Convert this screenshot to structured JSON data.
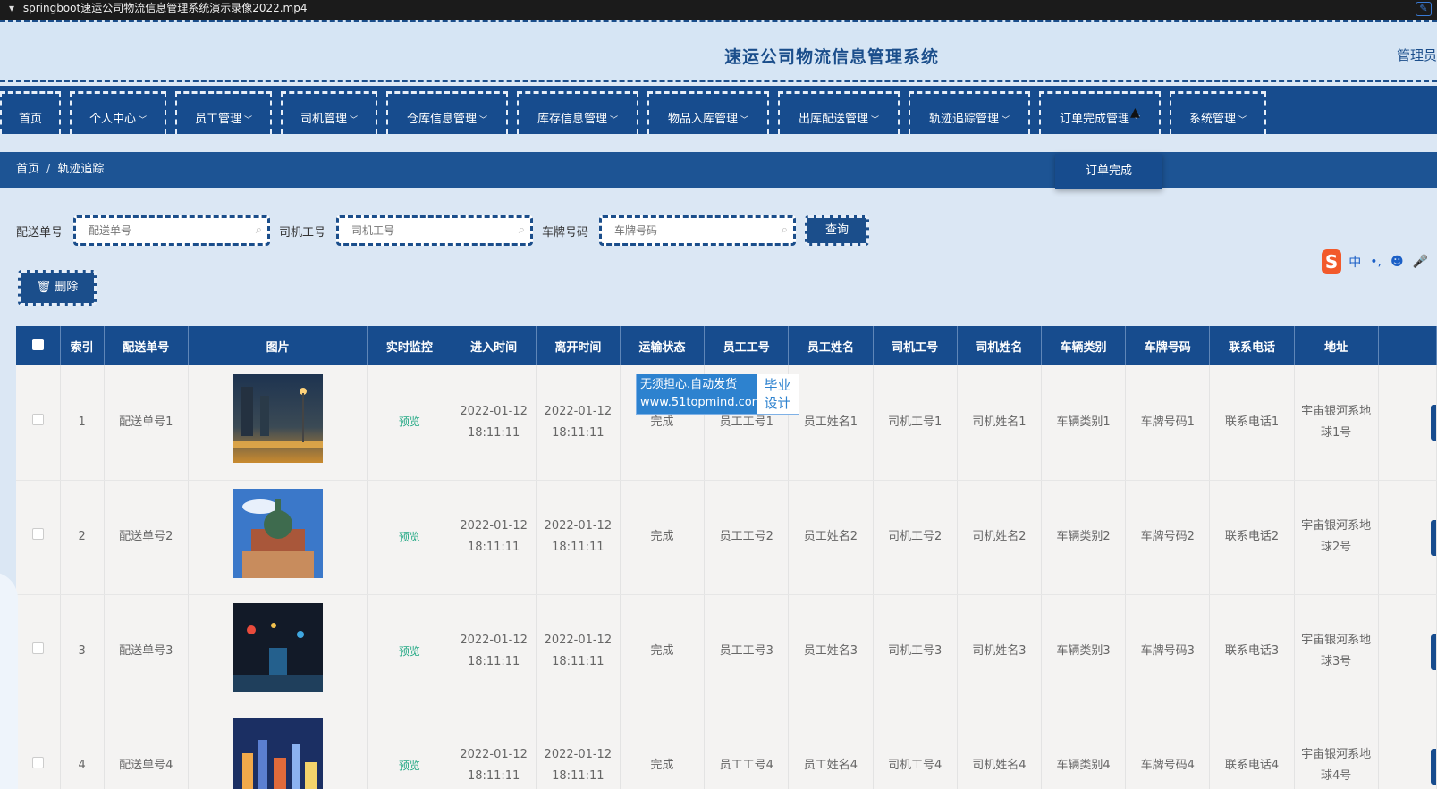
{
  "video_bar": {
    "title": "springboot速运公司物流信息管理系统演示录像2022.mp4"
  },
  "header": {
    "title": "速运公司物流信息管理系统",
    "user": "管理员"
  },
  "nav": {
    "items": [
      {
        "label": "首页",
        "has_dropdown": false
      },
      {
        "label": "个人中心",
        "has_dropdown": true
      },
      {
        "label": "员工管理",
        "has_dropdown": true
      },
      {
        "label": "司机管理",
        "has_dropdown": true
      },
      {
        "label": "仓库信息管理",
        "has_dropdown": true
      },
      {
        "label": "库存信息管理",
        "has_dropdown": true
      },
      {
        "label": "物品入库管理",
        "has_dropdown": true
      },
      {
        "label": "出库配送管理",
        "has_dropdown": true
      },
      {
        "label": "轨迹追踪管理",
        "has_dropdown": true
      },
      {
        "label": "订单完成管理",
        "has_dropdown": true
      },
      {
        "label": "系统管理",
        "has_dropdown": true
      }
    ],
    "dropdown_item": "订单完成"
  },
  "breadcrumb": {
    "home": "首页",
    "sep": "/",
    "current": "轨迹追踪"
  },
  "search": {
    "delivery_label": "配送单号",
    "delivery_placeholder": "配送单号",
    "driver_label": "司机工号",
    "driver_placeholder": "司机工号",
    "plate_label": "车牌号码",
    "plate_placeholder": "车牌号码",
    "query_button": "查询"
  },
  "actions": {
    "delete_button": "删除"
  },
  "ime": {
    "mode": "中",
    "punct": "•,",
    "emoji": "☻",
    "mic": "🎤"
  },
  "watermark": {
    "line1": "无须担心.自动发货",
    "line2": "www.51topmind.com",
    "right1": "毕业",
    "right2": "设计"
  },
  "table": {
    "headers": [
      "索引",
      "配送单号",
      "图片",
      "实时监控",
      "进入时间",
      "离开时间",
      "运输状态",
      "员工工号",
      "员工姓名",
      "司机工号",
      "司机姓名",
      "车辆类别",
      "车牌号码",
      "联系电话",
      "地址"
    ],
    "rows": [
      {
        "index": "1",
        "order": "配送单号1",
        "monitor": "预览",
        "enter": "2022-01-12 18:11:11",
        "leave": "2022-01-12 18:11:11",
        "status": "完成",
        "emp_id": "员工工号1",
        "emp_name": "员工姓名1",
        "drv_id": "司机工号1",
        "drv_name": "司机姓名1",
        "vehicle": "车辆类别1",
        "plate": "车牌号码1",
        "phone": "联系电话1",
        "address": "宇宙银河系地球1号"
      },
      {
        "index": "2",
        "order": "配送单号2",
        "monitor": "预览",
        "enter": "2022-01-12 18:11:11",
        "leave": "2022-01-12 18:11:11",
        "status": "完成",
        "emp_id": "员工工号2",
        "emp_name": "员工姓名2",
        "drv_id": "司机工号2",
        "drv_name": "司机姓名2",
        "vehicle": "车辆类别2",
        "plate": "车牌号码2",
        "phone": "联系电话2",
        "address": "宇宙银河系地球2号"
      },
      {
        "index": "3",
        "order": "配送单号3",
        "monitor": "预览",
        "enter": "2022-01-12 18:11:11",
        "leave": "2022-01-12 18:11:11",
        "status": "完成",
        "emp_id": "员工工号3",
        "emp_name": "员工姓名3",
        "drv_id": "司机工号3",
        "drv_name": "司机姓名3",
        "vehicle": "车辆类别3",
        "plate": "车牌号码3",
        "phone": "联系电话3",
        "address": "宇宙银河系地球3号"
      },
      {
        "index": "4",
        "order": "配送单号4",
        "monitor": "预览",
        "enter": "2022-01-12 18:11:11",
        "leave": "2022-01-12 18:11:11",
        "status": "完成",
        "emp_id": "员工工号4",
        "emp_name": "员工姓名4",
        "drv_id": "司机工号4",
        "drv_name": "司机姓名4",
        "vehicle": "车辆类别4",
        "plate": "车牌号码4",
        "phone": "联系电话4",
        "address": "宇宙银河系地球4号"
      }
    ]
  },
  "colors": {
    "primary": "#174c8e",
    "background": "#dbe7f4",
    "preview_link": "#22a884"
  }
}
